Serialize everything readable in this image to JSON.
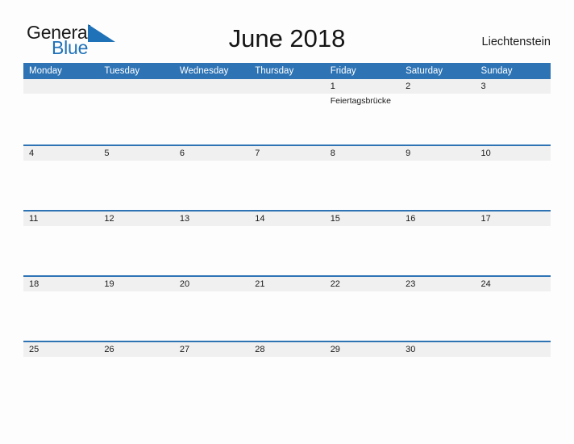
{
  "brand": {
    "name_part1": "General",
    "name_part2": "Blue",
    "flag_icon": "blue-triangle-flag-icon",
    "dark_color": "#1b1b1b",
    "blue_color": "#1f72b8"
  },
  "header": {
    "title": "June 2018",
    "region": "Liechtenstein"
  },
  "theme": {
    "header_blue": "#2e74b5",
    "row_band_gray": "#f0f0f0",
    "page_background": "#fdfdfd",
    "text_color": "#1b1b1b",
    "header_text_color": "#ffffff"
  },
  "calendar": {
    "weekdays": [
      "Monday",
      "Tuesday",
      "Wednesday",
      "Thursday",
      "Friday",
      "Saturday",
      "Sunday"
    ],
    "weeks": [
      {
        "days": [
          {
            "number": "",
            "event": ""
          },
          {
            "number": "",
            "event": ""
          },
          {
            "number": "",
            "event": ""
          },
          {
            "number": "",
            "event": ""
          },
          {
            "number": "1",
            "event": "Feiertagsbrücke"
          },
          {
            "number": "2",
            "event": ""
          },
          {
            "number": "3",
            "event": ""
          }
        ]
      },
      {
        "days": [
          {
            "number": "4",
            "event": ""
          },
          {
            "number": "5",
            "event": ""
          },
          {
            "number": "6",
            "event": ""
          },
          {
            "number": "7",
            "event": ""
          },
          {
            "number": "8",
            "event": ""
          },
          {
            "number": "9",
            "event": ""
          },
          {
            "number": "10",
            "event": ""
          }
        ]
      },
      {
        "days": [
          {
            "number": "11",
            "event": ""
          },
          {
            "number": "12",
            "event": ""
          },
          {
            "number": "13",
            "event": ""
          },
          {
            "number": "14",
            "event": ""
          },
          {
            "number": "15",
            "event": ""
          },
          {
            "number": "16",
            "event": ""
          },
          {
            "number": "17",
            "event": ""
          }
        ]
      },
      {
        "days": [
          {
            "number": "18",
            "event": ""
          },
          {
            "number": "19",
            "event": ""
          },
          {
            "number": "20",
            "event": ""
          },
          {
            "number": "21",
            "event": ""
          },
          {
            "number": "22",
            "event": ""
          },
          {
            "number": "23",
            "event": ""
          },
          {
            "number": "24",
            "event": ""
          }
        ]
      },
      {
        "days": [
          {
            "number": "25",
            "event": ""
          },
          {
            "number": "26",
            "event": ""
          },
          {
            "number": "27",
            "event": ""
          },
          {
            "number": "28",
            "event": ""
          },
          {
            "number": "29",
            "event": ""
          },
          {
            "number": "30",
            "event": ""
          },
          {
            "number": "",
            "event": ""
          }
        ]
      }
    ]
  }
}
